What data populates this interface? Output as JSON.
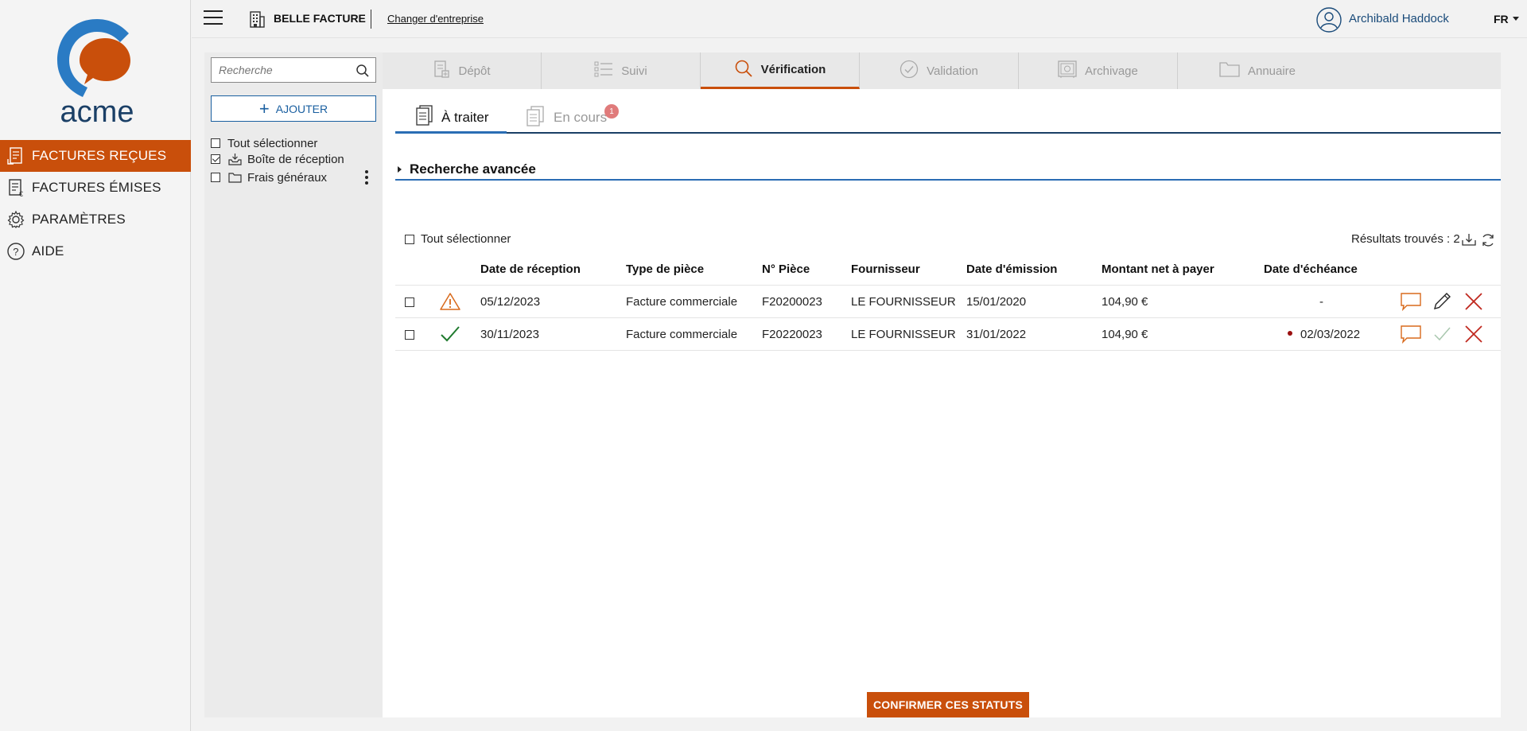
{
  "sidebar": {
    "logo_text": "acme",
    "items": [
      {
        "label": "FACTURES REÇUES",
        "icon": "received-invoices-icon",
        "active": true
      },
      {
        "label": "FACTURES ÉMISES",
        "icon": "issued-invoices-icon",
        "active": false
      },
      {
        "label": "PARAMÈTRES",
        "icon": "gear-icon",
        "active": false
      },
      {
        "label": "AIDE",
        "icon": "help-icon",
        "active": false
      }
    ]
  },
  "topbar": {
    "company_name": "BELLE FACTURE",
    "change_company": "Changer d'entreprise",
    "user_name": "Archibald Haddock",
    "language": "FR"
  },
  "folders": {
    "search_placeholder": "Recherche",
    "add_label": "AJOUTER",
    "select_all": "Tout sélectionner",
    "items": [
      {
        "label": "Boîte de réception",
        "checked": true
      },
      {
        "label": "Frais généraux",
        "checked": false
      }
    ]
  },
  "main_tabs": [
    {
      "label": "Dépôt",
      "icon": "deposit-icon",
      "active": false
    },
    {
      "label": "Suivi",
      "icon": "list-icon",
      "active": false
    },
    {
      "label": "Vérification",
      "icon": "search-icon",
      "active": true
    },
    {
      "label": "Validation",
      "icon": "check-circle-icon",
      "active": false
    },
    {
      "label": "Archivage",
      "icon": "safe-icon",
      "active": false
    },
    {
      "label": "Annuaire",
      "icon": "folder-icon",
      "active": false
    }
  ],
  "sub_tabs": [
    {
      "label": "À traiter",
      "active": true
    },
    {
      "label": "En cours",
      "active": false,
      "badge": "1"
    }
  ],
  "advanced_search": "Recherche avancée",
  "table": {
    "select_all": "Tout sélectionner",
    "results_label": "Résultats trouvés : 2",
    "headers": [
      "Date de réception",
      "Type de pièce",
      "N° Pièce",
      "Fournisseur",
      "Date d'émission",
      "Montant net à payer",
      "Date d'échéance"
    ],
    "rows": [
      {
        "status": "warning-icon",
        "reception": "05/12/2023",
        "type": "Facture commerciale",
        "number": "F20200023",
        "supplier": "LE FOURNISSEUR",
        "issue": "15/01/2020",
        "amount": "104,90 €",
        "due": "-",
        "overdue": false
      },
      {
        "status": "check-icon",
        "reception": "30/11/2023",
        "type": "Facture commerciale",
        "number": "F20220023",
        "supplier": "LE FOURNISSEUR",
        "issue": "31/01/2022",
        "amount": "104,90 €",
        "due": "02/03/2022",
        "overdue": true
      }
    ]
  },
  "confirm_label": "CONFIRMER CES STATUTS",
  "colors": {
    "accent": "#c94f0b",
    "brand_blue": "#1a5fa0",
    "logo_blue": "#2a7bc4"
  }
}
